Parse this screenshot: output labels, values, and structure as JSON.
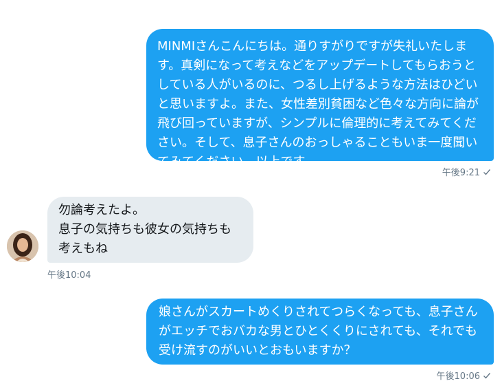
{
  "conversation": {
    "messages": [
      {
        "direction": "sent",
        "text": "MINMIさんこんにちは。通りすがりですが失礼いたします。真剣になって考えなどをアップデートしてもらおうとしている人がいるのに、つるし上げるような方法はひどいと思いますよ。また、女性差別貧困など色々な方向に論が飛び回っていますが、シンプルに倫理的に考えてみてください。そして、息子さんのおっしゃることもいま一度聞いてみてください。以上です。",
        "time": "午後9:21",
        "status_icon": "check-icon"
      },
      {
        "direction": "received",
        "text": "勿論考えたよ。\n息子の気持ちも彼女の気持ちも考えもね",
        "time": "午後10:04",
        "avatar_icon": "avatar"
      },
      {
        "direction": "sent",
        "text": "娘さんがスカートめくりされてつらくなっても、息子さんがエッチでおバカな男とひとくくりにされても、それでも受け流すのがいいとおもいますか？",
        "time": "午後10:06",
        "status_icon": "check-icon"
      }
    ]
  },
  "colors": {
    "sent_bubble": "#1da1f2",
    "received_bubble": "#e6ecf0",
    "meta_text": "#657786"
  }
}
